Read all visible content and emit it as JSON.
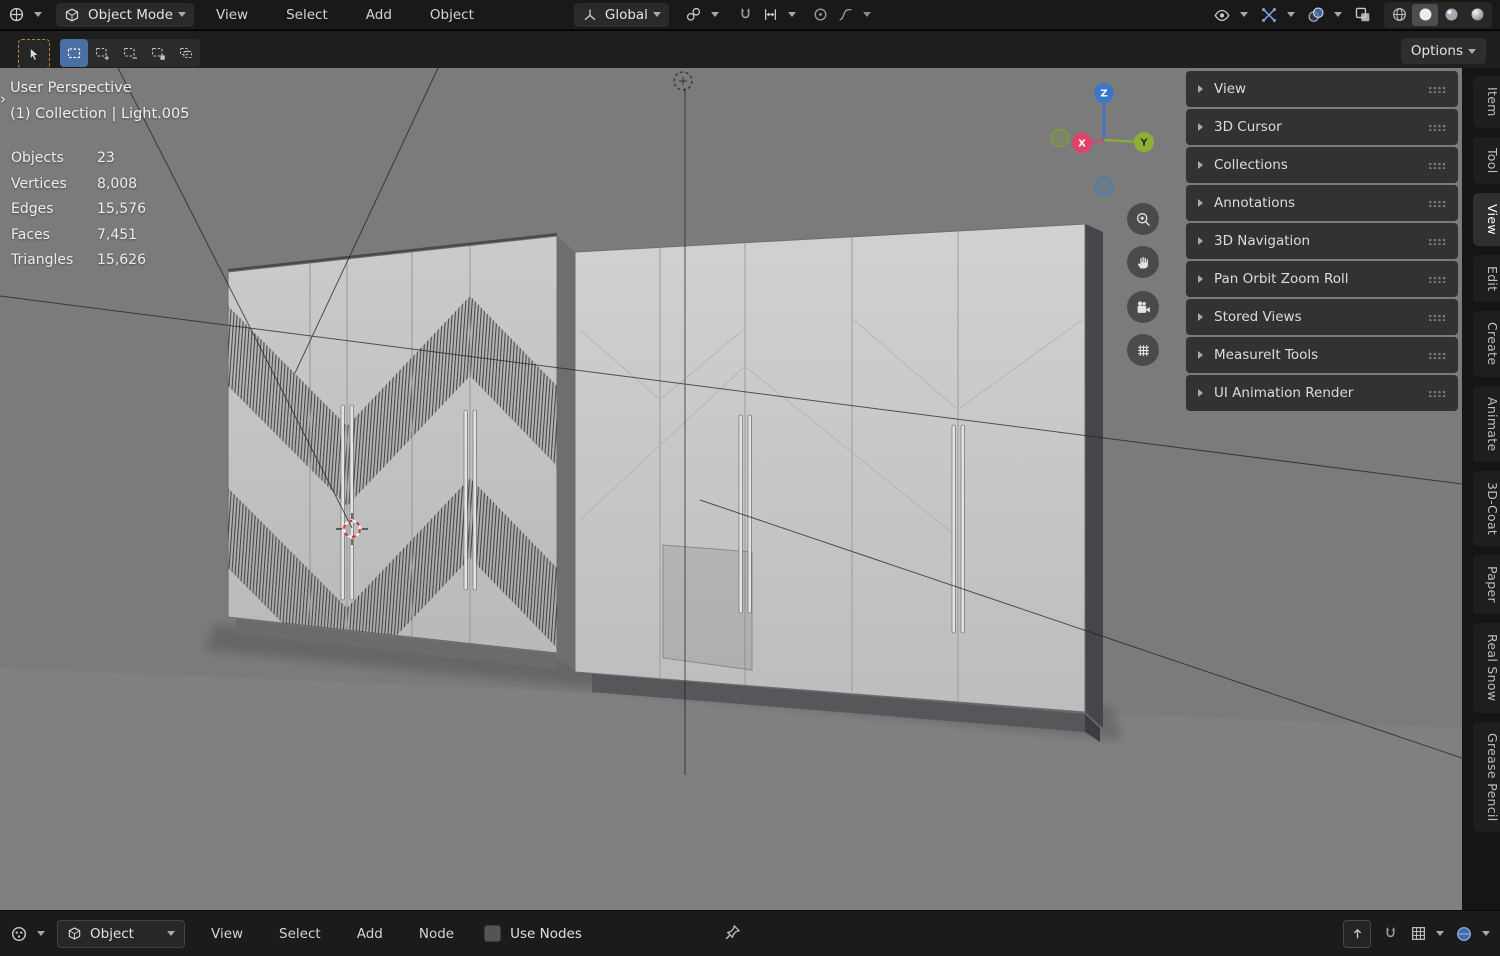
{
  "top_header": {
    "mode_label": "Object Mode",
    "menus": [
      "View",
      "Select",
      "Add",
      "Object"
    ],
    "orientation_label": "Global"
  },
  "tool_header": {
    "options_label": "Options"
  },
  "viewport": {
    "perspective_label": "User Perspective",
    "collection_label": "(1) Collection | Light.005",
    "stats": [
      {
        "label": "Objects",
        "value": "23"
      },
      {
        "label": "Vertices",
        "value": "8,008"
      },
      {
        "label": "Edges",
        "value": "15,576"
      },
      {
        "label": "Faces",
        "value": "7,451"
      },
      {
        "label": "Triangles",
        "value": "15,626"
      }
    ],
    "gizmo": {
      "x": "X",
      "y": "Y",
      "z": "Z"
    }
  },
  "sidebar": {
    "panels": [
      "View",
      "3D Cursor",
      "Collections",
      "Annotations",
      "3D Navigation",
      "Pan Orbit Zoom Roll",
      "Stored Views",
      "MeasureIt Tools",
      "UI Animation Render"
    ],
    "tabs": [
      "Item",
      "Tool",
      "View",
      "Edit",
      "Create",
      "Animate",
      "3D-Coat",
      "Paper",
      "Real Snow",
      "Grease Pencil"
    ],
    "active_tab": "View"
  },
  "bottom_bar": {
    "editor_label": "Object",
    "menus": [
      "View",
      "Select",
      "Add",
      "Node"
    ],
    "use_nodes_label": "Use Nodes",
    "use_nodes_checked": false
  },
  "colors": {
    "accent_blue": "#4772b3",
    "axis_x": "#e0426a",
    "axis_y": "#8fae35",
    "axis_z": "#3d76c9",
    "viewport_bg": "#7b7b7b",
    "header_bg": "#1d1d1d",
    "panel_bg": "#2f2f2f"
  },
  "icons": {
    "chevron-down-icon": "css-triangle-down",
    "panel-expand-icon": "css-triangle-right",
    "grip-dots-icon": "dot-grid-4x2",
    "editor-type-icon": "svg-globe-axes",
    "cube-icon": "svg-cube",
    "axes-icon": "svg-axes",
    "pivot-icon": "svg-two-circles",
    "magnet-icon": "svg-magnet",
    "snap-target-icon": "svg-snap-arrows",
    "proportional-icon": "svg-circle-dot",
    "falloff-icon": "svg-curve",
    "eye-icon": "svg-eye",
    "gizmo-icon": "svg-cross-arrows",
    "overlays-icon": "svg-two-spheres",
    "xray-icon": "svg-square-overlap",
    "wireframe-shading-icon": "svg-wire-sphere",
    "solid-shading-icon": "svg-white-sphere",
    "material-shading-icon": "svg-material-sphere",
    "rendered-shading-icon": "svg-render-sphere",
    "tweak-cursor-icon": "svg-arrow-cursor",
    "select-box-icon": "svg-dashed-box",
    "zoom-icon": "svg-magnifier",
    "pan-hand-icon": "svg-hand",
    "camera-view-icon": "svg-camera",
    "grid-view-icon": "svg-grid",
    "shader-editor-icon": "svg-node-sphere",
    "pin-icon": "svg-pushpin",
    "up-arrow-icon": "svg-arrow-up",
    "snap-grid-icon": "svg-grid-box",
    "viewer-sphere-icon": "svg-blue-sphere",
    "3d-cursor-icon": "red-white-dashed-crosshair"
  }
}
